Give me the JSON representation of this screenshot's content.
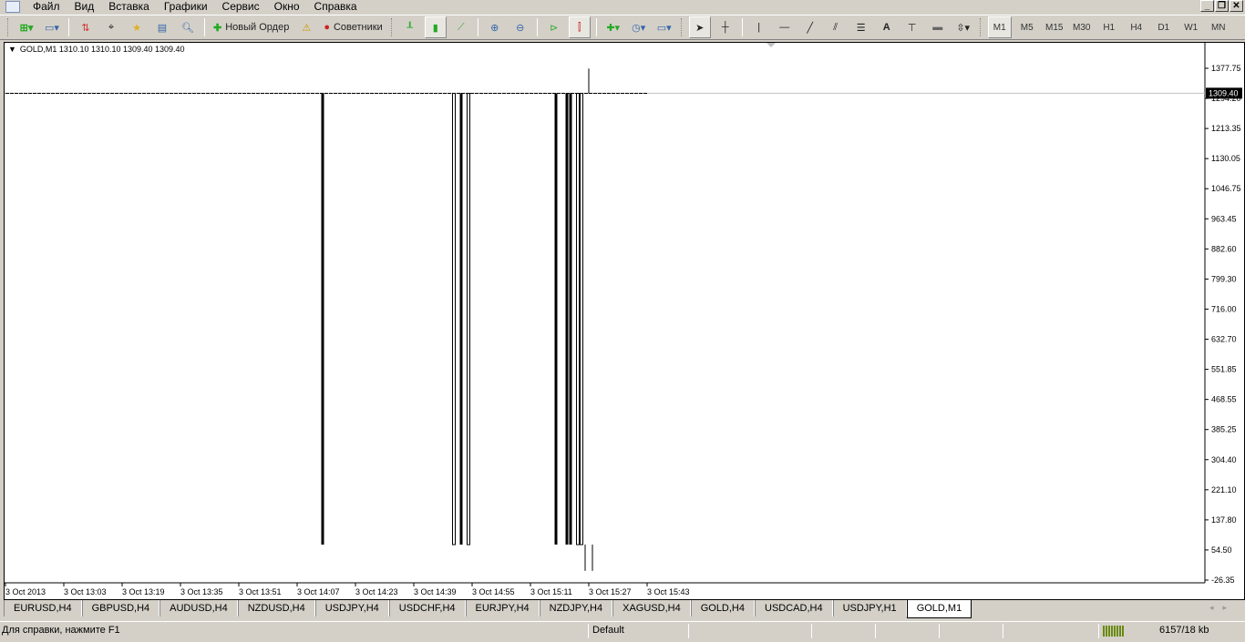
{
  "menu": [
    "Файл",
    "Вид",
    "Вставка",
    "Графики",
    "Сервис",
    "Окно",
    "Справка"
  ],
  "toolbar": {
    "new_order": "Новый Ордер",
    "experts": "Советники",
    "timeframes": [
      "M1",
      "M5",
      "M15",
      "M30",
      "H1",
      "H4",
      "D1",
      "W1",
      "MN"
    ],
    "active_timeframe": "M1"
  },
  "chart": {
    "legend": "GOLD,M1  1310.10 1310.10 1309.40 1309.40",
    "current_price": "1309.40",
    "price_labels": [
      "1377.75",
      "1294.20",
      "1213.35",
      "1130.05",
      "1046.75",
      "963.45",
      "882.60",
      "799.30",
      "716.00",
      "632.70",
      "551.85",
      "468.55",
      "385.25",
      "304.40",
      "221.10",
      "137.80",
      "54.50",
      "-26.35"
    ],
    "time_labels": [
      "3 Oct 2013",
      "3 Oct 13:03",
      "3 Oct 13:19",
      "3 Oct 13:35",
      "3 Oct 13:51",
      "3 Oct 14:07",
      "3 Oct 14:23",
      "3 Oct 14:39",
      "3 Oct 14:55",
      "3 Oct 15:11",
      "3 Oct 15:27",
      "3 Oct 15:43"
    ],
    "price_range": [
      -26.35,
      1377.75
    ],
    "base_price": 1309.0,
    "last_bar": 176,
    "spikes": [
      {
        "bar": 87,
        "low": 71,
        "style": "filled"
      },
      {
        "bar": 123,
        "low": 71,
        "style": "hollow"
      },
      {
        "bar": 125,
        "low": 71,
        "style": "filled"
      },
      {
        "bar": 127,
        "low": 71,
        "style": "hollow"
      },
      {
        "bar": 151,
        "low": 71,
        "style": "filled"
      },
      {
        "bar": 154,
        "low": 71,
        "style": "filled"
      },
      {
        "bar": 155,
        "low": 71,
        "style": "filled"
      },
      {
        "bar": 157,
        "low": 71,
        "style": "hollow"
      },
      {
        "bar": 158,
        "low": 71,
        "style": "hollow"
      },
      {
        "bar": 159,
        "low": -1,
        "style": "line"
      },
      {
        "bar": 161,
        "low": -1,
        "style": "line"
      }
    ],
    "up_spikes": [
      {
        "bar": 160,
        "high": 1377
      }
    ]
  },
  "tabs": [
    "EURUSD,H4",
    "GBPUSD,H4",
    "AUDUSD,H4",
    "NZDUSD,H4",
    "USDJPY,H4",
    "USDCHF,H4",
    "EURJPY,H4",
    "NZDJPY,H4",
    "XAGUSD,H4",
    "GOLD,H4",
    "USDCAD,H4",
    "USDJPY,H1",
    "GOLD,M1"
  ],
  "active_tab": "GOLD,M1",
  "status": {
    "help": "Для справки, нажмите F1",
    "profile": "Default",
    "traffic": "6157/18 kb"
  }
}
